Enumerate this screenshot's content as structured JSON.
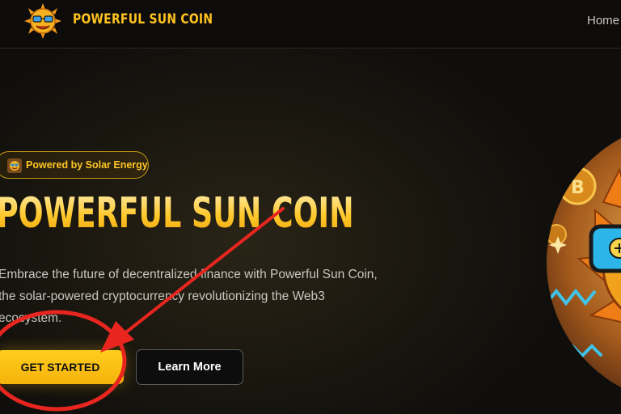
{
  "navbar": {
    "brand_name": "POWERFUL SUN COIN",
    "links": [
      {
        "label": "Home"
      }
    ]
  },
  "hero": {
    "badge_label": "Powered by Solar Energy",
    "title": "POWERFUL SUN COIN",
    "description": "Embrace the future of decentralized finance with Powerful Sun Coin, the solar-powered cryptocurrency revolutionizing the Web3 ecosystem.",
    "primary_button": "GET STARTED",
    "secondary_button": "Learn More"
  },
  "icons": {
    "brand": "sun-mascot-icon",
    "badge": "sun-mascot-icon",
    "hero_art": "sun-coin-illustration"
  },
  "colors": {
    "accent": "#ffc21f",
    "background": "#0f0e0c",
    "annotation": "#e8261f"
  }
}
